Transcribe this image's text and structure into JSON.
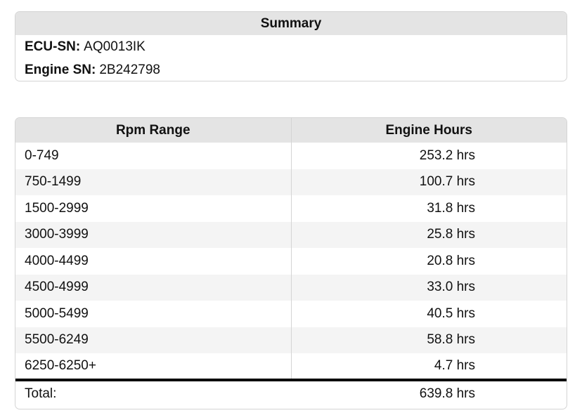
{
  "summary": {
    "title": "Summary",
    "ecu_sn_label": "ECU-SN:",
    "ecu_sn_value": "AQ0013IK",
    "engine_sn_label": "Engine SN:",
    "engine_sn_value": "2B242798"
  },
  "hours_table": {
    "columns": [
      "Rpm Range",
      "Engine Hours"
    ],
    "rows": [
      {
        "range": "0-749",
        "hours": "253.2 hrs"
      },
      {
        "range": "750-1499",
        "hours": "100.7 hrs"
      },
      {
        "range": "1500-2999",
        "hours": "31.8 hrs"
      },
      {
        "range": "3000-3999",
        "hours": "25.8 hrs"
      },
      {
        "range": "4000-4499",
        "hours": "20.8 hrs"
      },
      {
        "range": "4500-4999",
        "hours": "33.0 hrs"
      },
      {
        "range": "5000-5499",
        "hours": "40.5 hrs"
      },
      {
        "range": "5500-6249",
        "hours": "58.8 hrs"
      },
      {
        "range": "6250-6250+",
        "hours": "4.7 hrs"
      }
    ],
    "total_label": "Total:",
    "total_value": "639.8 hrs"
  }
}
